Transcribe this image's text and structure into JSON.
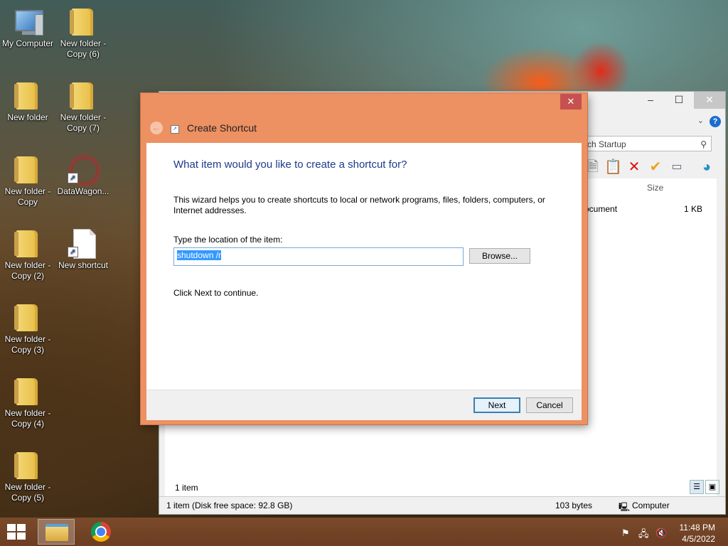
{
  "desktop": {
    "icons": [
      {
        "label": "My Computer",
        "icon": "computer-icon"
      },
      {
        "label": "New folder - Copy (6)",
        "icon": "folder-icon"
      },
      {
        "label": "New folder",
        "icon": "folder-icon"
      },
      {
        "label": "New folder - Copy (7)",
        "icon": "folder-icon"
      },
      {
        "label": "New folder - Copy",
        "icon": "folder-icon"
      },
      {
        "label": "DataWagon...",
        "icon": "web-shortcut-icon"
      },
      {
        "label": "New folder - Copy (2)",
        "icon": "folder-icon"
      },
      {
        "label": "New shortcut",
        "icon": "shortcut-file-icon"
      },
      {
        "label": "New folder - Copy (3)",
        "icon": "folder-icon"
      },
      {
        "label": "New folder - Copy (4)",
        "icon": "folder-icon"
      },
      {
        "label": "New folder - Copy (5)",
        "icon": "folder-icon"
      }
    ]
  },
  "explorer": {
    "search_placeholder": "rch Startup",
    "column_size": "Size",
    "row_name": "ocument",
    "row_size": "1 KB",
    "items_count": "1 item",
    "status": {
      "disk": "1 item (Disk free space: 92.8 GB)",
      "bytes": "103 bytes",
      "location": "Computer"
    }
  },
  "dialog": {
    "title": "Create Shortcut",
    "close_glyph": "✕",
    "heading": "What item would you like to create a shortcut for?",
    "description": "This wizard helps you to create shortcuts to local or network programs, files, folders, computers, or Internet addresses.",
    "location_label": "Type the location of the item:",
    "location_value": "shutdown /r",
    "browse_label": "Browse...",
    "continue_text": "Click Next to continue.",
    "next_label": "Next",
    "cancel_label": "Cancel"
  },
  "taskbar": {
    "time": "11:48 PM",
    "date": "4/5/2022"
  }
}
